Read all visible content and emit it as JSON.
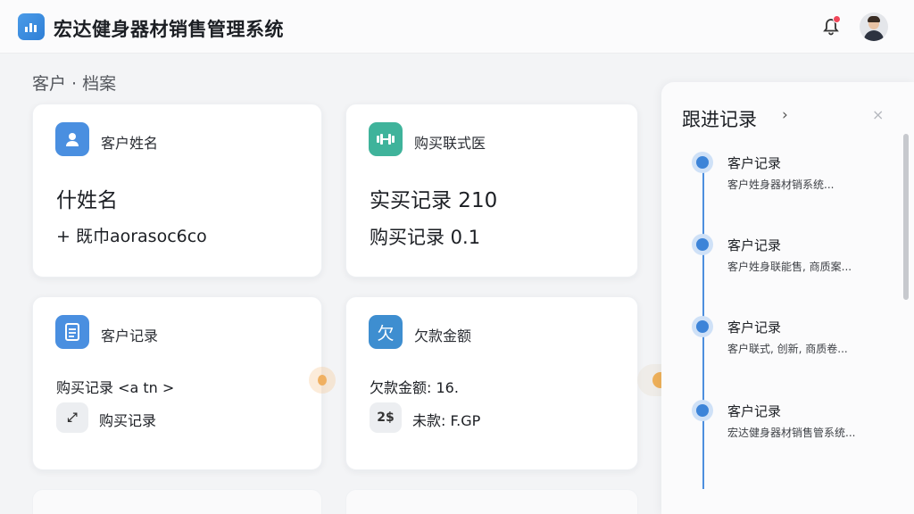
{
  "header": {
    "logo_icon": "chart-logo-icon",
    "title": "宏达健身器材销售管理系统",
    "subtitle": "",
    "notification_icon": "bell-icon",
    "avatar_icon": "user-avatar"
  },
  "breadcrumb": "客户 · 档案",
  "cards": [
    {
      "icon": "user-icon",
      "icon_color": "#4a8fe0",
      "title": "客户姓名",
      "line1": "什姓名",
      "line2": "+ 既巾aorasoc6co"
    },
    {
      "icon": "dumbbell-icon",
      "icon_color": "#3fb39b",
      "title": "购买联式医",
      "line1": "实买记录 210",
      "line2": "购买记录 0.1"
    },
    {
      "icon": "document-icon",
      "icon_color": "#4a8fe0",
      "title": "客户记录",
      "line1": "购买记录 <a tn >",
      "row_icon_text": "⤢",
      "line2": "购买记录"
    },
    {
      "icon": "debt-icon",
      "icon_color": "#3e8ed0",
      "icon_text": "欠",
      "title": "欠款金额",
      "line1": "欠款金额: 16.",
      "row_icon_text": "2$",
      "line2": "未款: F.GP"
    }
  ],
  "panel": {
    "title": "跟进记录",
    "chevron": "›",
    "close": "×",
    "items": [
      {
        "title": "客户记录",
        "desc": "客户姓身器材销系统..."
      },
      {
        "title": "客户记录",
        "desc": "客户姓身联能售, 商质案..."
      },
      {
        "title": "客户记录",
        "desc": "客户联式, 创新, 商质卷..."
      },
      {
        "title": "客户记录",
        "desc": "宏达健身器材销售管系统..."
      }
    ]
  },
  "colors": {
    "accent": "#3d84d8",
    "highlight": "#eeb05a",
    "alert": "#f0475a"
  }
}
